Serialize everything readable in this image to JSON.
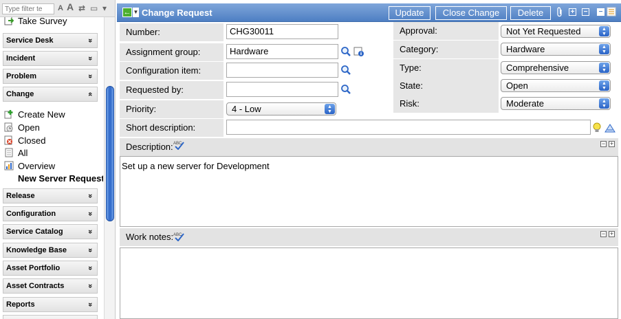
{
  "sidebar": {
    "filter_placeholder": "Type filter te",
    "toolbar_glyphs": [
      "A",
      "A",
      "⇄",
      "▭",
      "▾"
    ],
    "links_top": [
      {
        "label": "Take Survey",
        "icon": "survey-icon"
      }
    ],
    "sections_top": [
      {
        "label": "Service Desk",
        "chevron": "»"
      },
      {
        "label": "Incident",
        "chevron": "»"
      },
      {
        "label": "Problem",
        "chevron": "»"
      },
      {
        "label": "Change",
        "chevron": "«"
      }
    ],
    "change_items": [
      {
        "label": "Create New",
        "icon": "plus-icon"
      },
      {
        "label": "Open",
        "icon": "open-icon"
      },
      {
        "label": "Closed",
        "icon": "closed-icon"
      },
      {
        "label": "All",
        "icon": "document-icon"
      },
      {
        "label": "Overview",
        "icon": "chart-icon"
      },
      {
        "label": "New Server Request",
        "icon": "none"
      }
    ],
    "sections_bottom": [
      {
        "label": "Release",
        "chevron": "»"
      },
      {
        "label": "Configuration",
        "chevron": "»"
      },
      {
        "label": "Service Catalog",
        "chevron": "»"
      },
      {
        "label": "Knowledge Base",
        "chevron": "»"
      },
      {
        "label": "Asset Portfolio",
        "chevron": "»"
      },
      {
        "label": "Asset Contracts",
        "chevron": "»"
      },
      {
        "label": "Reports",
        "chevron": "»"
      }
    ]
  },
  "header": {
    "title": "Change Request",
    "buttons": {
      "update": "Update",
      "close_change": "Close Change",
      "delete": "Delete"
    }
  },
  "form": {
    "number": {
      "label": "Number:",
      "value": "CHG30011"
    },
    "assignment_group": {
      "label": "Assignment group:",
      "value": "Hardware"
    },
    "configuration_item": {
      "label": "Configuration item:",
      "value": ""
    },
    "requested_by": {
      "label": "Requested by:",
      "value": ""
    },
    "priority": {
      "label": "Priority:",
      "value": "4 - Low"
    },
    "short_description": {
      "label": "Short description:",
      "value": ""
    },
    "approval": {
      "label": "Approval:",
      "value": "Not Yet Requested"
    },
    "category": {
      "label": "Category:",
      "value": "Hardware"
    },
    "type": {
      "label": "Type:",
      "value": "Comprehensive"
    },
    "state": {
      "label": "State:",
      "value": "Open"
    },
    "risk": {
      "label": "Risk:",
      "value": "Moderate"
    },
    "description": {
      "label": "Description:",
      "value": "Set up a new server for Development"
    },
    "work_notes": {
      "label": "Work notes:",
      "value": ""
    }
  },
  "colors": {
    "header_blue": "#5b8bcb",
    "field_label_bg": "#e6e6e6",
    "select_arrow_blue": "#3a72d0"
  }
}
